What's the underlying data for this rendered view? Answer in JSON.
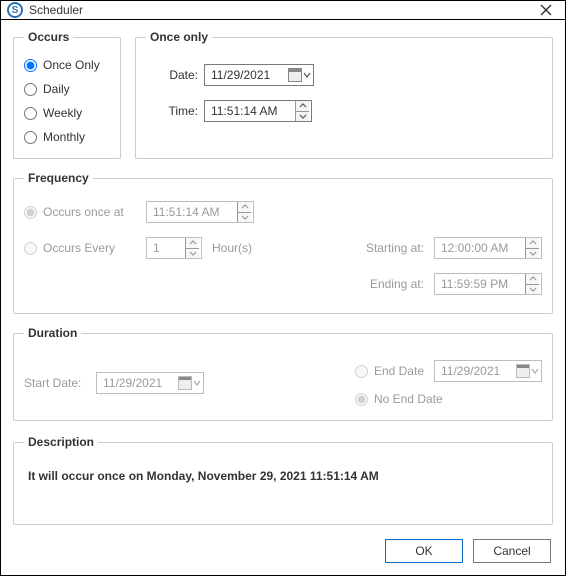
{
  "window": {
    "title": "Scheduler"
  },
  "occurs": {
    "legend": "Occurs",
    "options": {
      "once": "Once Only",
      "daily": "Daily",
      "weekly": "Weekly",
      "monthly": "Monthly"
    },
    "selected": "once"
  },
  "onceOnly": {
    "legend": "Once only",
    "dateLabel": "Date:",
    "dateValue": "11/29/2021",
    "timeLabel": "Time:",
    "timeValue": "11:51:14 AM"
  },
  "frequency": {
    "legend": "Frequency",
    "occursOnceLabel": "Occurs once at",
    "occursOnceValue": "11:51:14 AM",
    "occursEveryLabel": "Occurs Every",
    "occursEveryValue": "1",
    "occursEveryUnit": "Hour(s)",
    "startingLabel": "Starting at:",
    "startingValue": "12:00:00 AM",
    "endingLabel": "Ending at:",
    "endingValue": "11:59:59 PM"
  },
  "duration": {
    "legend": "Duration",
    "startLabel": "Start Date:",
    "startValue": "11/29/2021",
    "endDateLabel": "End Date",
    "endDateValue": "11/29/2021",
    "noEndLabel": "No End Date"
  },
  "description": {
    "legend": "Description",
    "text": "It will occur once on Monday, November 29, 2021 11:51:14 AM"
  },
  "buttons": {
    "ok": "OK",
    "cancel": "Cancel"
  }
}
